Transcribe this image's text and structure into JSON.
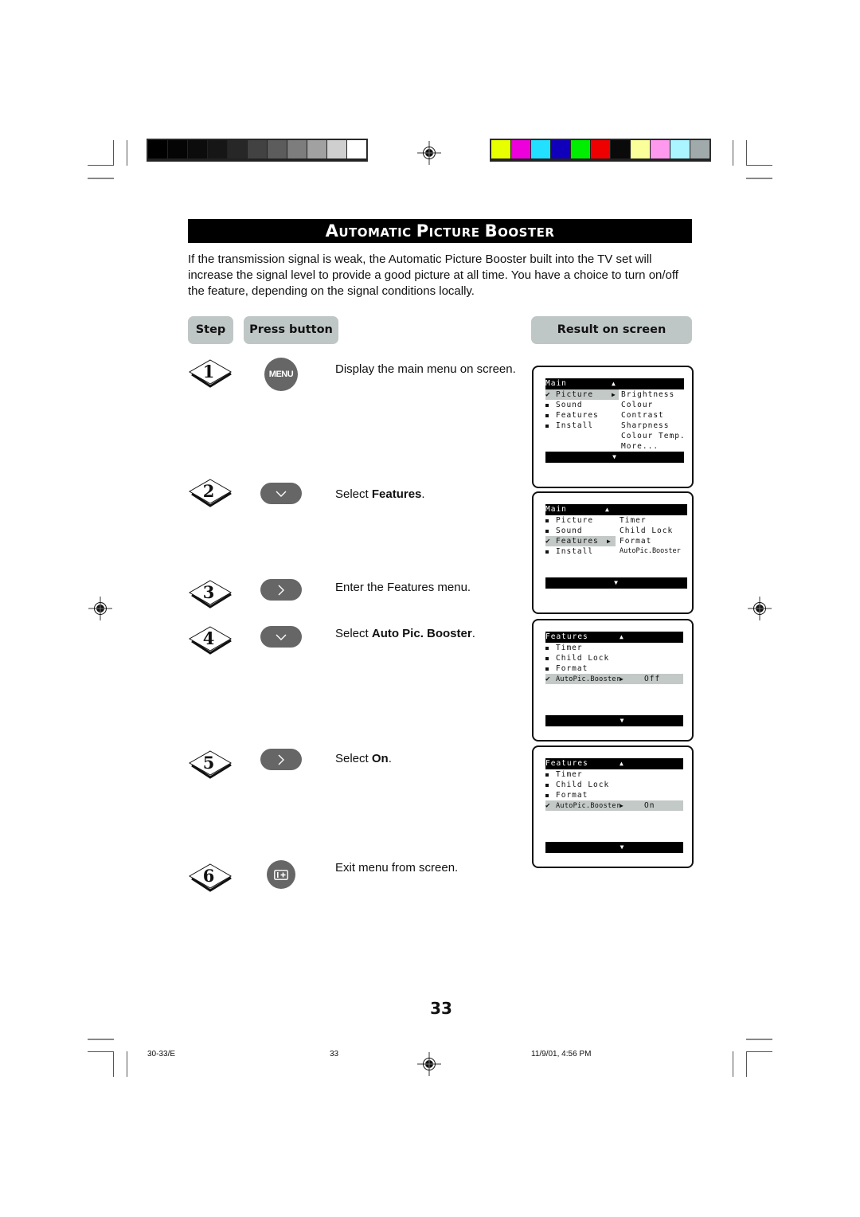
{
  "print_marks": {
    "grayscale_bar": [
      "#000000",
      "#050505",
      "#0c0c0c",
      "#161616",
      "#272727",
      "#424242",
      "#5c5c5c",
      "#7d7d7d",
      "#a1a1a1",
      "#cfcfcf",
      "#ffffff"
    ],
    "color_bar": [
      "#e8ff00",
      "#ee00dd",
      "#22e0ff",
      "#1100bb",
      "#00ee00",
      "#ee0000",
      "#0a0a0a",
      "#fbff9a",
      "#ff99ee",
      "#aaf5ff",
      "#a0aaaa"
    ]
  },
  "title": {
    "words": [
      {
        "cap": "A",
        "rest": "UTOMATIC"
      },
      {
        "cap": "P",
        "rest": "ICTURE"
      },
      {
        "cap": "B",
        "rest": "OOSTER"
      }
    ]
  },
  "intro": "If the transmission signal is weak, the Automatic Picture Booster built into the TV set will increase the signal level to provide a good picture at all time. You have a choice to turn on/off the feature, depending on the signal conditions locally.",
  "headers": {
    "step": "Step",
    "press_button": "Press button",
    "result": "Result on screen"
  },
  "steps": [
    {
      "number": "1",
      "button": "MENU",
      "button_icon": "menu-button",
      "text_pre": "Display the main menu on screen.",
      "text_bold": "",
      "text_post": ""
    },
    {
      "number": "2",
      "button_icon": "chevron-down-icon",
      "text_pre": "Select ",
      "text_bold": "Features",
      "text_post": "."
    },
    {
      "number": "3",
      "button_icon": "chevron-right-icon",
      "text_pre": "Enter the Features menu.",
      "text_bold": "",
      "text_post": ""
    },
    {
      "number": "4",
      "button_icon": "chevron-down-icon",
      "text_pre": "Select ",
      "text_bold": "Auto Pic. Booster",
      "text_post": "."
    },
    {
      "number": "5",
      "button_icon": "chevron-right-icon",
      "text_pre": "Select ",
      "text_bold": "On",
      "text_post": "."
    },
    {
      "number": "6",
      "button_icon": "osd-exit-icon",
      "text_pre": "Exit menu from screen.",
      "text_bold": "",
      "text_post": ""
    }
  ],
  "screens": [
    {
      "header": "Main",
      "left": [
        {
          "label": "Picture",
          "mark": "check",
          "selected": true,
          "arrow": true
        },
        {
          "label": "Sound",
          "mark": "square"
        },
        {
          "label": "Features",
          "mark": "square"
        },
        {
          "label": "Install",
          "mark": "square"
        }
      ],
      "right": [
        "Brightness",
        "Colour",
        "Contrast",
        "Sharpness",
        "Colour Temp.",
        "More..."
      ]
    },
    {
      "header": "Main",
      "left": [
        {
          "label": "Picture",
          "mark": "square"
        },
        {
          "label": "Sound",
          "mark": "square"
        },
        {
          "label": "Features",
          "mark": "check",
          "selected": true,
          "arrow": true
        },
        {
          "label": "Install",
          "mark": "square"
        }
      ],
      "right": [
        "Timer",
        "Child Lock",
        "Format",
        "AutoPic.Booster"
      ]
    },
    {
      "header": "Features",
      "left": [
        {
          "label": "Timer",
          "mark": "square"
        },
        {
          "label": "Child Lock",
          "mark": "square"
        },
        {
          "label": "Format",
          "mark": "square"
        },
        {
          "label": "AutoPic.Booster",
          "mark": "check",
          "selected": true,
          "arrow": true,
          "value": "Off"
        }
      ]
    },
    {
      "header": "Features",
      "left": [
        {
          "label": "Timer",
          "mark": "square"
        },
        {
          "label": "Child Lock",
          "mark": "square"
        },
        {
          "label": "Format",
          "mark": "square"
        },
        {
          "label": "AutoPic.Booster",
          "mark": "check",
          "selected": true,
          "arrow": true,
          "value": "On"
        }
      ]
    }
  ],
  "page_number": "33",
  "footer": {
    "file": "30-33/E",
    "page": "33",
    "timestamp": "11/9/01, 4:56 PM"
  }
}
